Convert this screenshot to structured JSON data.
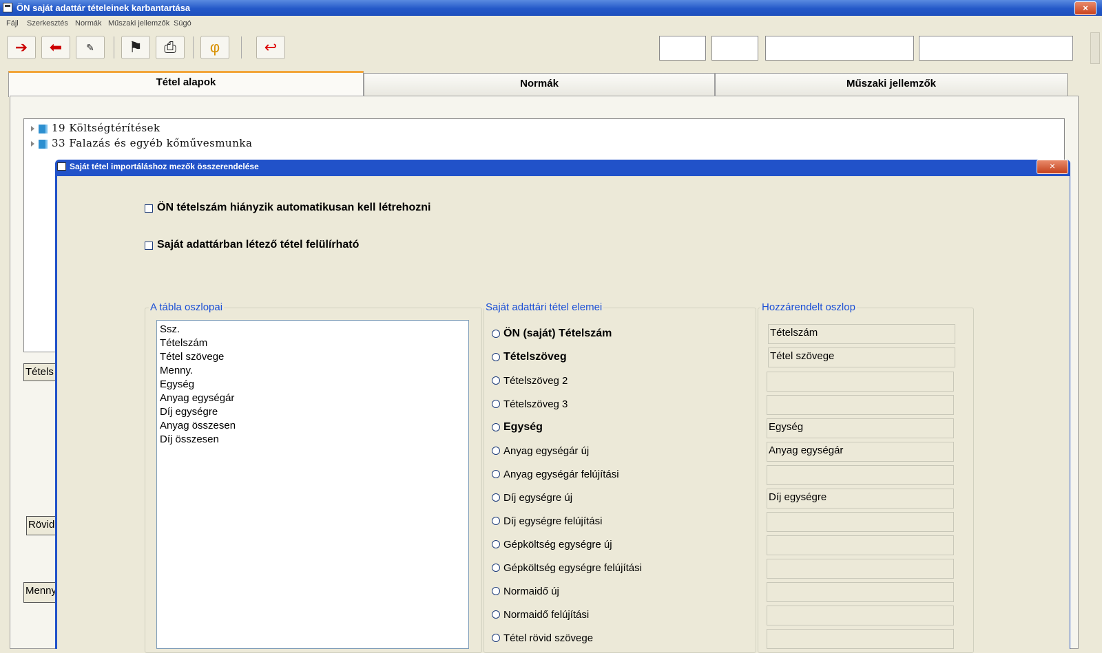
{
  "window": {
    "title": "ÖN saját adattár tételeinek karbantartása",
    "close": "×"
  },
  "menu": [
    "Fájl",
    "Szerkesztés",
    "Normák",
    "Műszaki jellemzők",
    "Súgó"
  ],
  "tabs": [
    "Tétel alapok",
    "Normák",
    "Műszaki jellemzők"
  ],
  "tree": [
    "19 Költségtérítések",
    "33 Falazás és egyéb kőművesmunka"
  ],
  "background_fields": [
    "Tétels",
    "Rövid",
    "Menny"
  ],
  "dialog": {
    "title": "Saját tétel importáláshoz mezők összerendelése",
    "close": "×",
    "checkboxes": [
      "ÖN tételszám hiányzik automatikusan kell létrehozni",
      "Saját adattárban létező tétel felülírható"
    ],
    "columns_group": {
      "legend": "A tábla oszlopai",
      "items": [
        "Ssz.",
        "Tételszám",
        "Tétel szövege",
        "Menny.",
        "Egység",
        "Anyag egységár",
        "Díj egységre",
        "Anyag összesen",
        "Díj összesen"
      ]
    },
    "elements_group": {
      "legend": "Saját adattári tétel elemei",
      "items": [
        {
          "label": "ÖN (saját) Tételszám",
          "bold": true
        },
        {
          "label": "Tételszöveg",
          "bold": true
        },
        {
          "label": "Tételszöveg 2",
          "bold": false
        },
        {
          "label": "Tételszöveg 3",
          "bold": false
        },
        {
          "label": "Egység",
          "bold": true
        },
        {
          "label": "Anyag egységár új",
          "bold": false
        },
        {
          "label": "Anyag egységár felújítási",
          "bold": false
        },
        {
          "label": "Díj egységre új",
          "bold": false
        },
        {
          "label": "Díj egységre felújítási",
          "bold": false
        },
        {
          "label": "Gépköltség egységre új",
          "bold": false
        },
        {
          "label": "Gépköltség egységre felújítási",
          "bold": false
        },
        {
          "label": "Normaidő új",
          "bold": false
        },
        {
          "label": "Normaidő felújítási",
          "bold": false
        },
        {
          "label": "Tétel rövid szövege",
          "bold": false
        }
      ]
    },
    "assigned_group": {
      "legend": "Hozzárendelt oszlop",
      "items": [
        "Tételszám",
        "Tétel szövege",
        "",
        "",
        "Egység",
        "Anyag egységár",
        "",
        "Díj egységre",
        "",
        "",
        "",
        "",
        "",
        ""
      ]
    }
  }
}
